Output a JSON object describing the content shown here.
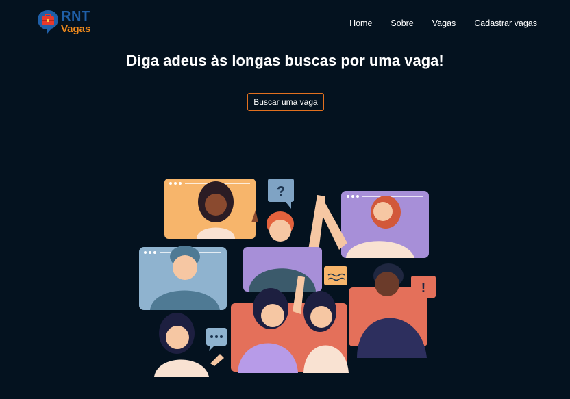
{
  "brand": {
    "line1": "RNT",
    "line2": "Vagas"
  },
  "nav": {
    "items": [
      "Home",
      "Sobre",
      "Vagas",
      "Cadastrar vagas"
    ]
  },
  "hero": {
    "headline": "Diga adeus às longas buscas por uma vaga!",
    "cta_label": "Buscar uma vaga"
  },
  "colors": {
    "background": "#04121f",
    "brand_blue": "#1f5fa8",
    "brand_orange": "#f08a1c",
    "cta_border": "#e2701f"
  },
  "icons": {
    "logo": "briefcase-chat-icon",
    "question": "question-bubble-icon",
    "exclaim": "exclamation-bubble-icon",
    "typing": "ellipsis-bubble-icon"
  }
}
